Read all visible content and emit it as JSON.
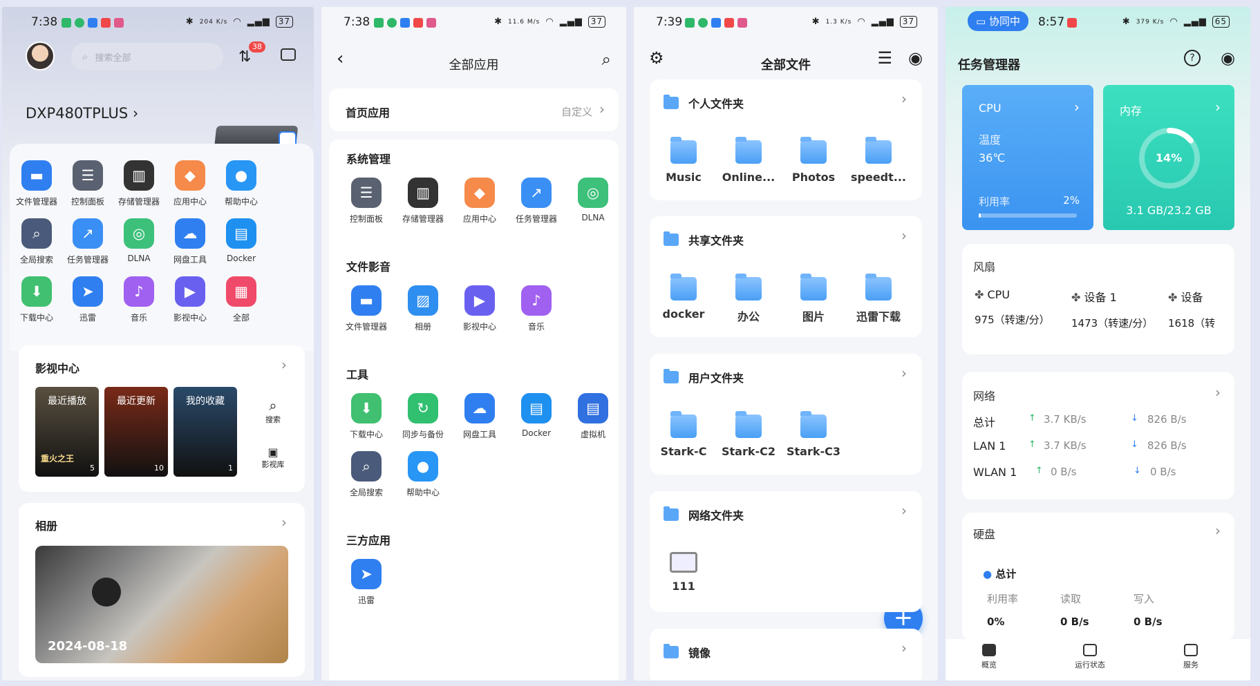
{
  "colors": {
    "accent": "#2f7ff0",
    "teal": "#2fd0b4",
    "badge": "#f04848"
  },
  "panel1": {
    "time": "7:38",
    "net_speed": "204 K/s",
    "battery": "37",
    "search_placeholder": "搜索全部",
    "badge": "38",
    "device": "DXP480TPLUS",
    "apps": [
      {
        "label": "文件管理器",
        "icon": "folder-icon",
        "color": "#2f7ff0"
      },
      {
        "label": "控制面板",
        "icon": "sliders-icon",
        "color": "#5a6170"
      },
      {
        "label": "存储管理器",
        "icon": "storage-icon",
        "color": "#333"
      },
      {
        "label": "应用中心",
        "icon": "app-center-icon",
        "color": "#f58a4a"
      },
      {
        "label": "帮助中心",
        "icon": "lightbulb-icon",
        "color": "#2896f5"
      },
      {
        "label": "全局搜索",
        "icon": "search-doc-icon",
        "color": "#4a5a7a"
      },
      {
        "label": "任务管理器",
        "icon": "chart-icon",
        "color": "#3a8ff5"
      },
      {
        "label": "DLNA",
        "icon": "dlna-icon",
        "color": "#3cc07a"
      },
      {
        "label": "网盘工具",
        "icon": "cloud-disk-icon",
        "color": "#2f7ff0"
      },
      {
        "label": "Docker",
        "icon": "docker-icon",
        "color": "#1e90f0"
      },
      {
        "label": "下载中心",
        "icon": "download-icon",
        "color": "#40c070"
      },
      {
        "label": "迅雷",
        "icon": "bird-icon",
        "color": "#2f7ff0"
      },
      {
        "label": "音乐",
        "icon": "music-icon",
        "color": "#a060f0"
      },
      {
        "label": "影视中心",
        "icon": "video-icon",
        "color": "#6a60f0"
      },
      {
        "label": "全部",
        "icon": "grid-icon",
        "color": "#f04a6a"
      }
    ],
    "media_title": "影视中心",
    "posters": [
      {
        "tag": "最近播放",
        "caption": "重火之王",
        "count": "5",
        "color": "#5a5040"
      },
      {
        "tag": "最近更新",
        "caption": "",
        "count": "10",
        "color": "#7a2a18"
      },
      {
        "tag": "我的收藏",
        "caption": "",
        "count": "1",
        "color": "#2a4a6a"
      }
    ],
    "media_search": "搜索",
    "media_library": "影视库",
    "album_title": "相册",
    "album_date": "2024-08-18"
  },
  "panel2": {
    "time": "7:38",
    "net_speed": "11.6 M/s",
    "battery": "37",
    "title": "全部应用",
    "home_apps": "首页应用",
    "customize": "自定义",
    "sections": [
      {
        "title": "系统管理",
        "apps": [
          {
            "label": "控制面板",
            "icon": "sliders-icon",
            "color": "#5a6170"
          },
          {
            "label": "存储管理器",
            "icon": "storage-icon",
            "color": "#333"
          },
          {
            "label": "应用中心",
            "icon": "app-center-icon",
            "color": "#f58a4a"
          },
          {
            "label": "任务管理器",
            "icon": "chart-icon",
            "color": "#3a8ff5"
          },
          {
            "label": "DLNA",
            "icon": "dlna-icon",
            "color": "#3cc07a"
          }
        ]
      },
      {
        "title": "文件影音",
        "apps": [
          {
            "label": "文件管理器",
            "icon": "folder-icon",
            "color": "#2f7ff0"
          },
          {
            "label": "相册",
            "icon": "image-icon",
            "color": "#2f8ff0"
          },
          {
            "label": "影视中心",
            "icon": "video-icon",
            "color": "#6a60f0"
          },
          {
            "label": "音乐",
            "icon": "music-icon",
            "color": "#a060f0"
          }
        ]
      },
      {
        "title": "工具",
        "apps": [
          {
            "label": "下载中心",
            "icon": "download-icon",
            "color": "#40c070"
          },
          {
            "label": "同步与备份",
            "icon": "sync-icon",
            "color": "#30c070"
          },
          {
            "label": "网盘工具",
            "icon": "cloud-disk-icon",
            "color": "#2f7ff0"
          },
          {
            "label": "Docker",
            "icon": "docker-icon",
            "color": "#1e90f0"
          },
          {
            "label": "虚拟机",
            "icon": "vm-icon",
            "color": "#3070e0"
          },
          {
            "label": "全局搜索",
            "icon": "search-doc-icon",
            "color": "#4a5a7a"
          },
          {
            "label": "帮助中心",
            "icon": "lightbulb-icon",
            "color": "#2896f5"
          }
        ]
      },
      {
        "title": "三方应用",
        "apps": [
          {
            "label": "迅雷",
            "icon": "bird-icon",
            "color": "#2f7ff0"
          }
        ]
      }
    ]
  },
  "panel3": {
    "time": "7:39",
    "net_speed": "1.3 K/s",
    "battery": "37",
    "title": "全部文件",
    "groups": [
      {
        "title": "个人文件夹",
        "items": [
          "Music",
          "Online...",
          "Photos",
          "speedt..."
        ]
      },
      {
        "title": "共享文件夹",
        "items": [
          "docker",
          "办公",
          "图片",
          "迅雷下载"
        ]
      },
      {
        "title": "用户文件夹",
        "items": [
          "Stark-C",
          "Stark-C2",
          "Stark-C3"
        ]
      },
      {
        "title": "网络文件夹",
        "items": [
          "111"
        ]
      },
      {
        "title": "镜像",
        "items": []
      }
    ],
    "fab": "+"
  },
  "panel4": {
    "collab": "协同中",
    "time": "8:57",
    "net_speed": "379 K/s",
    "battery": "65",
    "title": "任务管理器",
    "cpu": {
      "label": "CPU",
      "temp_label": "温度",
      "temp": "36℃",
      "usage_label": "利用率",
      "usage": "2%",
      "usage_value": 0.02
    },
    "mem": {
      "label": "内存",
      "pct": "14%",
      "pct_value": 0.14,
      "detail": "3.1 GB/23.2 GB"
    },
    "fan": {
      "title": "风扇",
      "items": [
        {
          "name": "CPU",
          "speed": "975（转速/分）"
        },
        {
          "name": "设备 1",
          "speed": "1473（转速/分）"
        },
        {
          "name": "设备",
          "speed": "1618（转"
        }
      ]
    },
    "network": {
      "title": "网络",
      "rows": [
        {
          "name": "总计",
          "up": "3.7 KB/s",
          "down": "826 B/s"
        },
        {
          "name": "LAN 1",
          "up": "3.7 KB/s",
          "down": "826 B/s"
        },
        {
          "name": "WLAN 1",
          "up": "0 B/s",
          "down": "0 B/s"
        }
      ]
    },
    "disk": {
      "title": "硬盘",
      "total": "总计",
      "cols": [
        {
          "label": "利用率",
          "value": "0%"
        },
        {
          "label": "读取",
          "value": "0 B/s"
        },
        {
          "label": "写入",
          "value": "0 B/s"
        }
      ]
    },
    "tabs": [
      "概览",
      "运行状态",
      "服务"
    ]
  }
}
